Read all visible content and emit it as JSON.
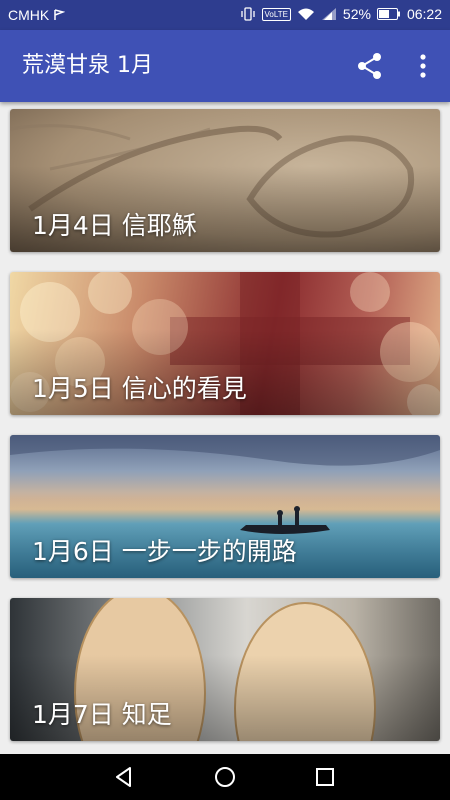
{
  "status_bar": {
    "carrier": "CMHK",
    "volte": "VoLTE",
    "battery": "52%",
    "time": "06:22"
  },
  "app_bar": {
    "title": "荒漠甘泉 1月",
    "share_icon": "share-icon",
    "more_icon": "more-vert-icon"
  },
  "cards": [
    {
      "label": "1月4日 信耶穌"
    },
    {
      "label": "1月5日 信心的看見"
    },
    {
      "label": "1月6日 一步一步的開路"
    },
    {
      "label": "1月7日 知足"
    }
  ],
  "nav_bar": {
    "back_icon": "back-triangle-icon",
    "home_icon": "home-circle-icon",
    "recents_icon": "recents-square-icon"
  }
}
